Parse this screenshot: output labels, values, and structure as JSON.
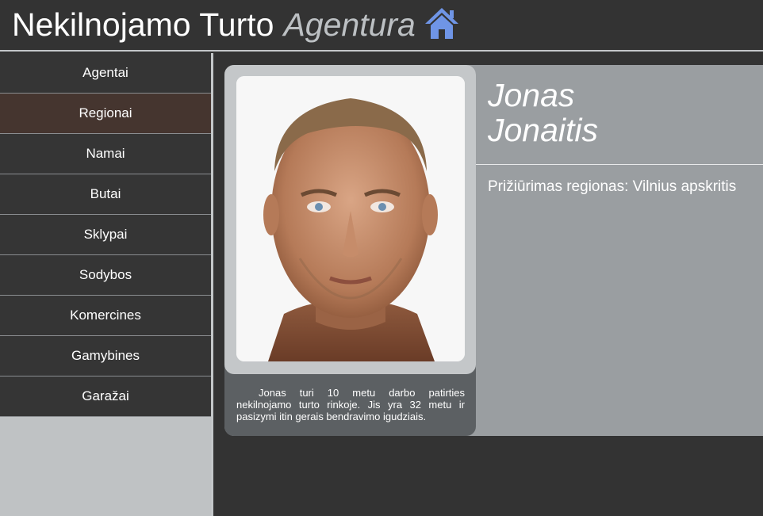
{
  "header": {
    "brand_main": "Nekilnojamo Turto",
    "brand_sub": "Agentura",
    "icon": "home-icon",
    "icon_color": "#6f95e6"
  },
  "sidebar": {
    "items": [
      {
        "label": "Agentai"
      },
      {
        "label": "Regionai"
      },
      {
        "label": "Namai"
      },
      {
        "label": "Butai"
      },
      {
        "label": "Sklypai"
      },
      {
        "label": "Sodybos"
      },
      {
        "label": "Komercines"
      },
      {
        "label": "Gamybines"
      },
      {
        "label": "Garažai"
      }
    ],
    "active_item": "Regionai"
  },
  "agent": {
    "first_name": "Jonas",
    "last_name": "Jonaitis",
    "region_text": "Prižiūrimas regionas: Vilnius apskritis",
    "bio": "Jonas turi 10 metu darbo patirties nekilnojamo turto rinkoje. Jis yra 32 metu ir pasizymi itin gerais bendravimo igudziais.",
    "photo": "agent-portrait"
  },
  "colors": {
    "background": "#333333",
    "nav_item": "#353535",
    "nav_active": "#45352f",
    "card": "#9a9ea1",
    "accent_icon": "#6f95e6"
  }
}
